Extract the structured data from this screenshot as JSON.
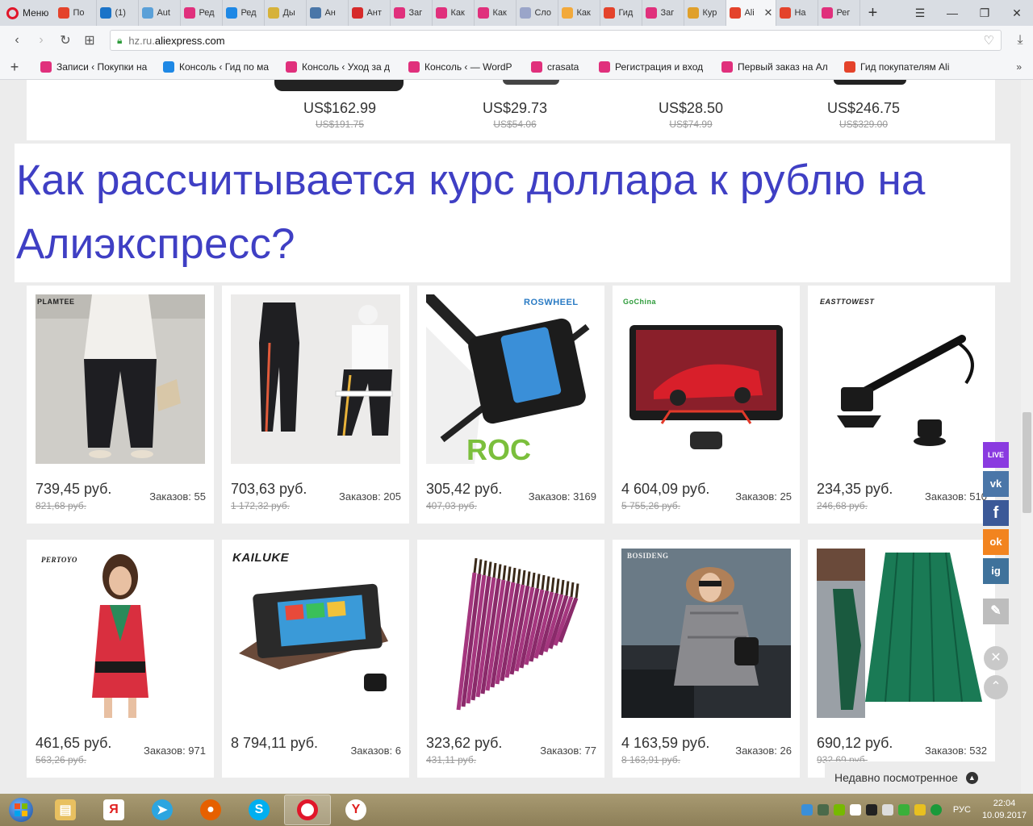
{
  "browser": {
    "menu_label": "Меню",
    "tabs": [
      {
        "label": "По",
        "color": "#e4432b"
      },
      {
        "label": "(1)",
        "color": "#1a73c8"
      },
      {
        "label": "Aut",
        "color": "#5aa0d8"
      },
      {
        "label": "Ред",
        "color": "#e0307c"
      },
      {
        "label": "Ред",
        "color": "#1e88e5"
      },
      {
        "label": "Ды",
        "color": "#d6b23a"
      },
      {
        "label": "Ан",
        "color": "#4a76a8"
      },
      {
        "label": "Ант",
        "color": "#d62a2a"
      },
      {
        "label": "Заг",
        "color": "#e0307c"
      },
      {
        "label": "Как",
        "color": "#e0307c"
      },
      {
        "label": "Как",
        "color": "#e0307c"
      },
      {
        "label": "Сло",
        "color": "#9aa5c9"
      },
      {
        "label": "Как",
        "color": "#f2a93b"
      },
      {
        "label": "Гид",
        "color": "#e4432b"
      },
      {
        "label": "Заг",
        "color": "#e0307c"
      },
      {
        "label": "Кур",
        "color": "#e0a02b"
      },
      {
        "label": "Ali",
        "color": "#e4432b"
      },
      {
        "label": "На",
        "color": "#e4432b"
      },
      {
        "label": "Рег",
        "color": "#e0307c"
      }
    ],
    "url_prefix": "hz.ru.",
    "url_domain": "aliexpress.com"
  },
  "bookmarks": [
    {
      "label": "Записи ‹ Покупки на",
      "color": "#e0307c"
    },
    {
      "label": "Консоль ‹ Гид по ма",
      "color": "#1e88e5"
    },
    {
      "label": "Консоль ‹ Уход за д",
      "color": "#e0307c"
    },
    {
      "label": "Консоль ‹ — WordP",
      "color": "#e0307c"
    },
    {
      "label": "crasata",
      "color": "#e0307c"
    },
    {
      "label": "Регистрация и вход",
      "color": "#e0307c"
    },
    {
      "label": "Первый заказ на Ал",
      "color": "#e0307c"
    },
    {
      "label": "Гид покупателям Ali",
      "color": "#e4432b"
    }
  ],
  "top_prices": [
    {
      "now": "US$162.99",
      "old": "US$191.75"
    },
    {
      "now": "US$29.73",
      "old": "US$54.06"
    },
    {
      "now": "US$28.50",
      "old": "US$74.99"
    },
    {
      "now": "US$246.75",
      "old": "US$329.00"
    }
  ],
  "headline": "Как рассчитывается курс доллара к рублю на Алиэкспресс?",
  "products_row1": [
    {
      "brand": "PLAMTEE",
      "price": "739,45 руб.",
      "old": "821,68 руб.",
      "orders": "Заказов: 55"
    },
    {
      "brand": "",
      "price": "703,63 руб.",
      "old": "1 172,32 руб.",
      "orders": "Заказов: 205"
    },
    {
      "brand": "ROSWHEEL",
      "price": "305,42 руб.",
      "old": "407,03 руб.",
      "orders": "Заказов: 3169"
    },
    {
      "brand": "GoChina",
      "price": "4 604,09 руб.",
      "old": "5 755,26 руб.",
      "orders": "Заказов: 25"
    },
    {
      "brand": "EASTTOWEST",
      "price": "234,35 руб.",
      "old": "246,68 руб.",
      "orders": "Заказов: 510"
    }
  ],
  "products_row2": [
    {
      "brand": "PERTOYO",
      "price": "461,65 руб.",
      "old": "563,26 руб.",
      "orders": "Заказов: 971"
    },
    {
      "brand": "KAILUKE",
      "price": "8 794,11 руб.",
      "old": "",
      "orders": "Заказов: 6"
    },
    {
      "brand": "",
      "price": "323,62 руб.",
      "old": "431,11 руб.",
      "orders": "Заказов: 77"
    },
    {
      "brand": "BOSIDENG",
      "price": "4 163,59 руб.",
      "old": "8 163,91 руб.",
      "orders": "Заказов: 26"
    },
    {
      "brand": "",
      "price": "690,12 руб.",
      "old": "932,69 руб.",
      "orders": "Заказов: 532"
    }
  ],
  "social": {
    "live": "LIVE",
    "vk": "vk",
    "fb": "f",
    "ok": "ok",
    "ig": "ig"
  },
  "recent_label": "Недавно посмотренное",
  "taskbar": {
    "lang": "РУС",
    "time": "22:04",
    "date": "10.09.2017"
  }
}
